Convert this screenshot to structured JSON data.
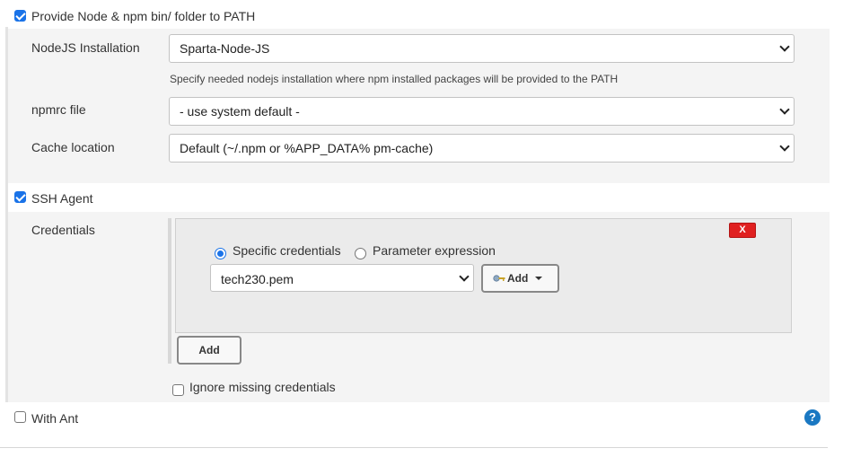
{
  "nodejs_section": {
    "checkbox_label": "Provide Node & npm bin/ folder to PATH",
    "installation_label": "NodeJS Installation",
    "installation_value": "Sparta-Node-JS",
    "installation_help": "Specify needed nodejs installation where npm installed packages will be provided to the PATH",
    "npmrc_label": "npmrc file",
    "npmrc_value": "- use system default -",
    "cache_label": "Cache location",
    "cache_value": "Default (~/.npm or %APP_DATA% pm-cache)"
  },
  "ssh_section": {
    "checkbox_label": "SSH Agent",
    "credentials_label": "Credentials",
    "delete_label": "X",
    "radio_specific": "Specific credentials",
    "radio_parameter": "Parameter expression",
    "credential_value": "tech230.pem",
    "add_dropdown_label": "Add",
    "add_button_label": "Add",
    "ignore_missing_label": "Ignore missing credentials"
  },
  "ant_section": {
    "checkbox_label": "With Ant",
    "help_icon_glyph": "?"
  },
  "colors": {
    "accent": "#1a73e8",
    "delete_red": "#e02020",
    "panel_bg": "#f4f4f4",
    "help_blue": "#1a78c2"
  }
}
